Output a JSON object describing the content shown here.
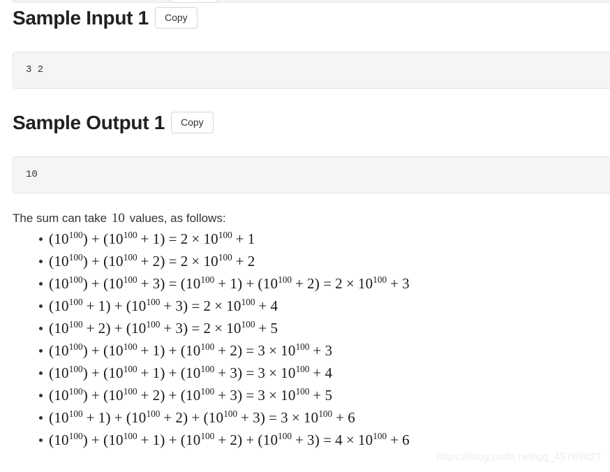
{
  "page": {
    "background": "#ffffff",
    "text_color": "#333333"
  },
  "sections": [
    {
      "heading": "Sample Input 1",
      "copy_label": "Copy",
      "code": "3 2"
    },
    {
      "heading": "Sample Output 1",
      "copy_label": "Copy",
      "code": "10"
    }
  ],
  "explanation": {
    "before": "The sum can take",
    "number": "10",
    "after": "values, as follows:"
  },
  "math_list": [
    {
      "terms": [
        {
          "base": "10",
          "exp": "100",
          "offset": null
        },
        {
          "base": "10",
          "exp": "100",
          "offset": "1"
        }
      ],
      "results": [
        {
          "coefficient": "2",
          "base": "10",
          "exp": "100",
          "offset": "1"
        }
      ]
    },
    {
      "terms": [
        {
          "base": "10",
          "exp": "100",
          "offset": null
        },
        {
          "base": "10",
          "exp": "100",
          "offset": "2"
        }
      ],
      "results": [
        {
          "coefficient": "2",
          "base": "10",
          "exp": "100",
          "offset": "2"
        }
      ]
    },
    {
      "terms": [
        {
          "base": "10",
          "exp": "100",
          "offset": null
        },
        {
          "base": "10",
          "exp": "100",
          "offset": "3"
        }
      ],
      "alt_terms": [
        {
          "base": "10",
          "exp": "100",
          "offset": "1"
        },
        {
          "base": "10",
          "exp": "100",
          "offset": "2"
        }
      ],
      "results": [
        {
          "coefficient": "2",
          "base": "10",
          "exp": "100",
          "offset": "3"
        }
      ]
    },
    {
      "terms": [
        {
          "base": "10",
          "exp": "100",
          "offset": "1"
        },
        {
          "base": "10",
          "exp": "100",
          "offset": "3"
        }
      ],
      "results": [
        {
          "coefficient": "2",
          "base": "10",
          "exp": "100",
          "offset": "4"
        }
      ]
    },
    {
      "terms": [
        {
          "base": "10",
          "exp": "100",
          "offset": "2"
        },
        {
          "base": "10",
          "exp": "100",
          "offset": "3"
        }
      ],
      "results": [
        {
          "coefficient": "2",
          "base": "10",
          "exp": "100",
          "offset": "5"
        }
      ]
    },
    {
      "terms": [
        {
          "base": "10",
          "exp": "100",
          "offset": null
        },
        {
          "base": "10",
          "exp": "100",
          "offset": "1"
        },
        {
          "base": "10",
          "exp": "100",
          "offset": "2"
        }
      ],
      "results": [
        {
          "coefficient": "3",
          "base": "10",
          "exp": "100",
          "offset": "3"
        }
      ]
    },
    {
      "terms": [
        {
          "base": "10",
          "exp": "100",
          "offset": null
        },
        {
          "base": "10",
          "exp": "100",
          "offset": "1"
        },
        {
          "base": "10",
          "exp": "100",
          "offset": "3"
        }
      ],
      "results": [
        {
          "coefficient": "3",
          "base": "10",
          "exp": "100",
          "offset": "4"
        }
      ]
    },
    {
      "terms": [
        {
          "base": "10",
          "exp": "100",
          "offset": null
        },
        {
          "base": "10",
          "exp": "100",
          "offset": "2"
        },
        {
          "base": "10",
          "exp": "100",
          "offset": "3"
        }
      ],
      "results": [
        {
          "coefficient": "3",
          "base": "10",
          "exp": "100",
          "offset": "5"
        }
      ]
    },
    {
      "terms": [
        {
          "base": "10",
          "exp": "100",
          "offset": "1"
        },
        {
          "base": "10",
          "exp": "100",
          "offset": "2"
        },
        {
          "base": "10",
          "exp": "100",
          "offset": "3"
        }
      ],
      "results": [
        {
          "coefficient": "3",
          "base": "10",
          "exp": "100",
          "offset": "6"
        }
      ]
    },
    {
      "terms": [
        {
          "base": "10",
          "exp": "100",
          "offset": null
        },
        {
          "base": "10",
          "exp": "100",
          "offset": "1"
        },
        {
          "base": "10",
          "exp": "100",
          "offset": "2"
        },
        {
          "base": "10",
          "exp": "100",
          "offset": "3"
        }
      ],
      "results": [
        {
          "coefficient": "4",
          "base": "10",
          "exp": "100",
          "offset": "6"
        }
      ]
    }
  ],
  "watermark": {
    "text": "https://blog.csdn.net/qq_45769627",
    "color": "#ededed"
  }
}
